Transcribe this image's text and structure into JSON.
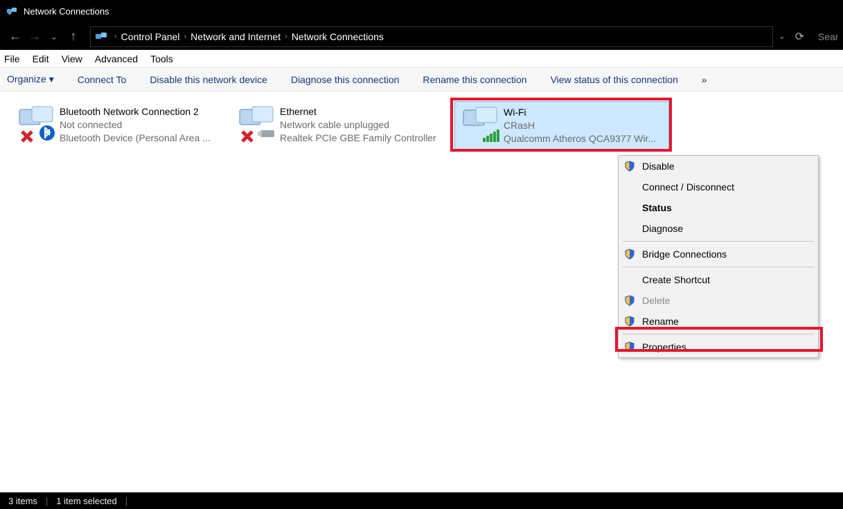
{
  "window": {
    "title": "Network Connections"
  },
  "breadcrumb": {
    "a": "Control Panel",
    "b": "Network and Internet",
    "c": "Network Connections"
  },
  "search": {
    "placeholder": "Sear"
  },
  "menu": {
    "file": "File",
    "edit": "Edit",
    "view": "View",
    "advanced": "Advanced",
    "tools": "Tools"
  },
  "cmd": {
    "organize": "Organize ▾",
    "connect": "Connect To",
    "disable": "Disable this network device",
    "diagnose": "Diagnose this connection",
    "rename": "Rename this connection",
    "viewstatus": "View status of this connection",
    "overflow": "»"
  },
  "connections": {
    "bt": {
      "name": "Bluetooth Network Connection 2",
      "line2": "Not connected",
      "line3": "Bluetooth Device (Personal Area ..."
    },
    "eth": {
      "name": "Ethernet",
      "line2": "Network cable unplugged",
      "line3": "Realtek PCIe GBE Family Controller"
    },
    "wifi": {
      "name": "Wi-Fi",
      "line2": "CRasH",
      "line3": "Qualcomm Atheros QCA9377 Wir..."
    }
  },
  "context": {
    "disable": "Disable",
    "connect": "Connect / Disconnect",
    "status": "Status",
    "diagnose": "Diagnose",
    "bridge": "Bridge Connections",
    "shortcut": "Create Shortcut",
    "delete": "Delete",
    "rename": "Rename",
    "properties": "Properties"
  },
  "status": {
    "items": "3 items",
    "selected": "1 item selected"
  }
}
